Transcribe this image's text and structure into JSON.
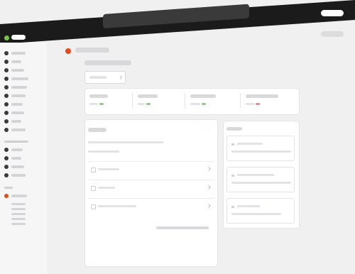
{
  "colors": {
    "chrome_dark": "#1b1b1b",
    "accent": "#e24b1b",
    "status_green": "#8fd276",
    "status_red": "#ea8c85",
    "window_green": "#7dc24b"
  },
  "icons": {
    "window_indicator": "green-dot-icon",
    "page_icon": "app-logo-icon",
    "chevron": "chevron-right-icon",
    "close": "close-icon"
  },
  "sidebar": {
    "group1_count": 10,
    "group2_count": 4,
    "active_section": "sub-nav"
  },
  "stats": {
    "cards": [
      {
        "status": "positive"
      },
      {
        "status": "positive"
      },
      {
        "status": "positive"
      },
      {
        "status": "negative"
      }
    ]
  }
}
